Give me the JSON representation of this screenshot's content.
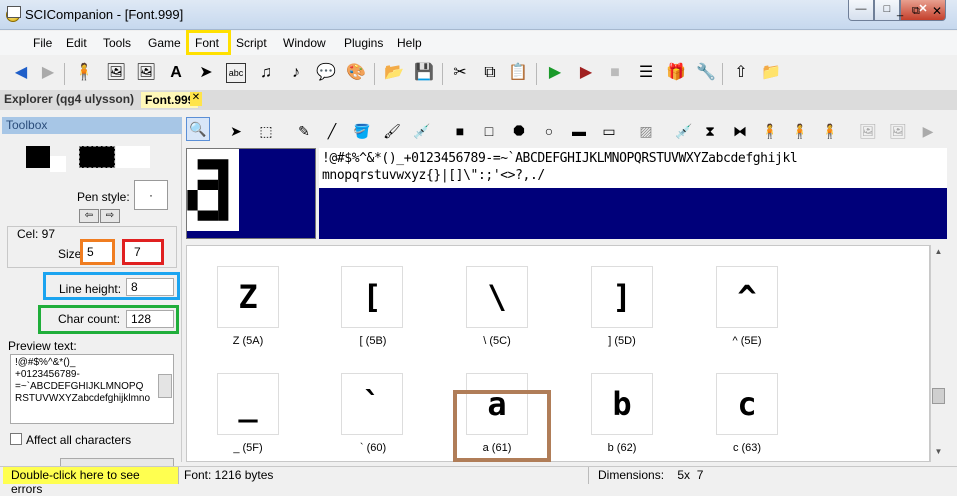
{
  "window": {
    "title": "SCICompanion - [Font.999]"
  },
  "titlebar_buttons": {
    "minimize": "—",
    "maximize": "□",
    "close": "✕"
  },
  "menu": {
    "items": [
      "File",
      "Edit",
      "Tools",
      "Game",
      "Font",
      "Script",
      "Window",
      "Plugins",
      "Help"
    ],
    "mdi": {
      "min": "_",
      "restore": "⧉",
      "close": "✕"
    }
  },
  "tabs": {
    "explorer": "Explorer (qg4 ulysson)",
    "font": "Font.999"
  },
  "toolbox": {
    "header": "Toolbox",
    "pen_style_label": "Pen style:",
    "pen_style_value": "·",
    "shift_left": "⇦",
    "shift_right": "⇨",
    "cel_label": "Cel: 97",
    "size_label": "Size",
    "size_w": "5",
    "size_h": "7",
    "line_height_label": "Line height:",
    "line_height": "8",
    "char_count_label": "Char count:",
    "char_count": "128",
    "preview_label": "Preview text:",
    "preview_text": "!@#$%^&*()_\n+0123456789-\n=~`ABCDEFGHIJKLMNOPQ\nRSTUVWXYZabcdefghijklmno",
    "affect_all_label": "Affect all characters"
  },
  "font_strip": {
    "line1": "!@#$%^&*()_+0123456789-=~`ABCDEFGHIJKLMNOPQRSTUVWXYZabcdefghijkl",
    "line2": "mnopqrstuvwxyz{}|[]\\\":;'<>?,./"
  },
  "glyph_grid": [
    {
      "glyph": "Z",
      "caption": "Z (5A)"
    },
    {
      "glyph": "[",
      "caption": "[ (5B)"
    },
    {
      "glyph": "\\",
      "caption": "\\ (5C)"
    },
    {
      "glyph": "]",
      "caption": "] (5D)"
    },
    {
      "glyph": "^",
      "caption": "^ (5E)"
    },
    {
      "glyph": "_",
      "caption": "_ (5F)"
    },
    {
      "glyph": "`",
      "caption": "` (60)"
    },
    {
      "glyph": "a",
      "caption": "a (61)"
    },
    {
      "glyph": "b",
      "caption": "b (62)"
    },
    {
      "glyph": "c",
      "caption": "c (63)"
    }
  ],
  "status": {
    "errors": "Double-click here to see errors",
    "font_size": "Font: 1216 bytes",
    "dimensions": "Dimensions:    5x  7"
  },
  "highlight_colors": {
    "font_menu": "#ffe000",
    "size_w": "#f07d20",
    "size_h": "#e02020",
    "line_height": "#1ba4f0",
    "char_count": "#1fae3a",
    "glyph_a": "#b07d58"
  }
}
